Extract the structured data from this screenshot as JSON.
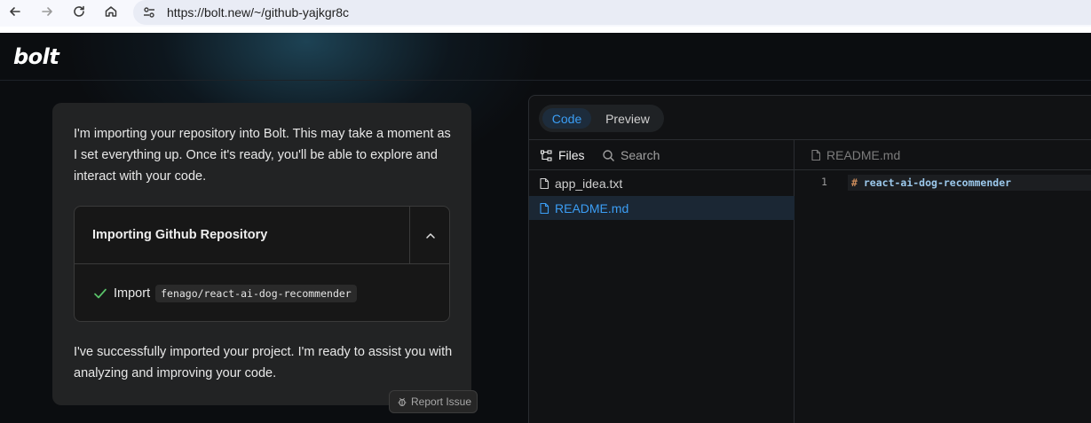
{
  "browser": {
    "url": "https://bolt.new/~/github-yajkgr8c",
    "icons": [
      "back-arrow-icon",
      "forward-arrow-icon",
      "reload-icon",
      "home-icon",
      "site-settings-icon"
    ]
  },
  "header": {
    "logo": "bolt"
  },
  "chat": {
    "intro": "I'm importing your repository into Bolt. This may take a moment as I set everything up. Once it's ready, you'll be able to explore and interact with your code.",
    "action_title": "Importing Github Repository",
    "import_label": "Import",
    "repo": "fenago/react-ai-dog-recommender",
    "done": "I've successfully imported your project. I'm ready to assist you with analyzing and improving your code.",
    "report_label": "Report Issue"
  },
  "workbench": {
    "view_tabs": [
      "Code",
      "Preview"
    ],
    "active_view": "Code",
    "tree_tabs": {
      "files": "Files",
      "search": "Search"
    },
    "files": [
      {
        "name": "app_idea.txt",
        "selected": false
      },
      {
        "name": "README.md",
        "selected": true
      }
    ],
    "editor": {
      "open_file": "README.md",
      "lines": [
        {
          "num": "1",
          "hash": "#",
          "text": "react-ai-dog-recommender"
        }
      ]
    }
  },
  "colors": {
    "accent": "#3b9ef5",
    "check": "#5ac46a",
    "card": "#222324",
    "background": "#0b0d10"
  }
}
